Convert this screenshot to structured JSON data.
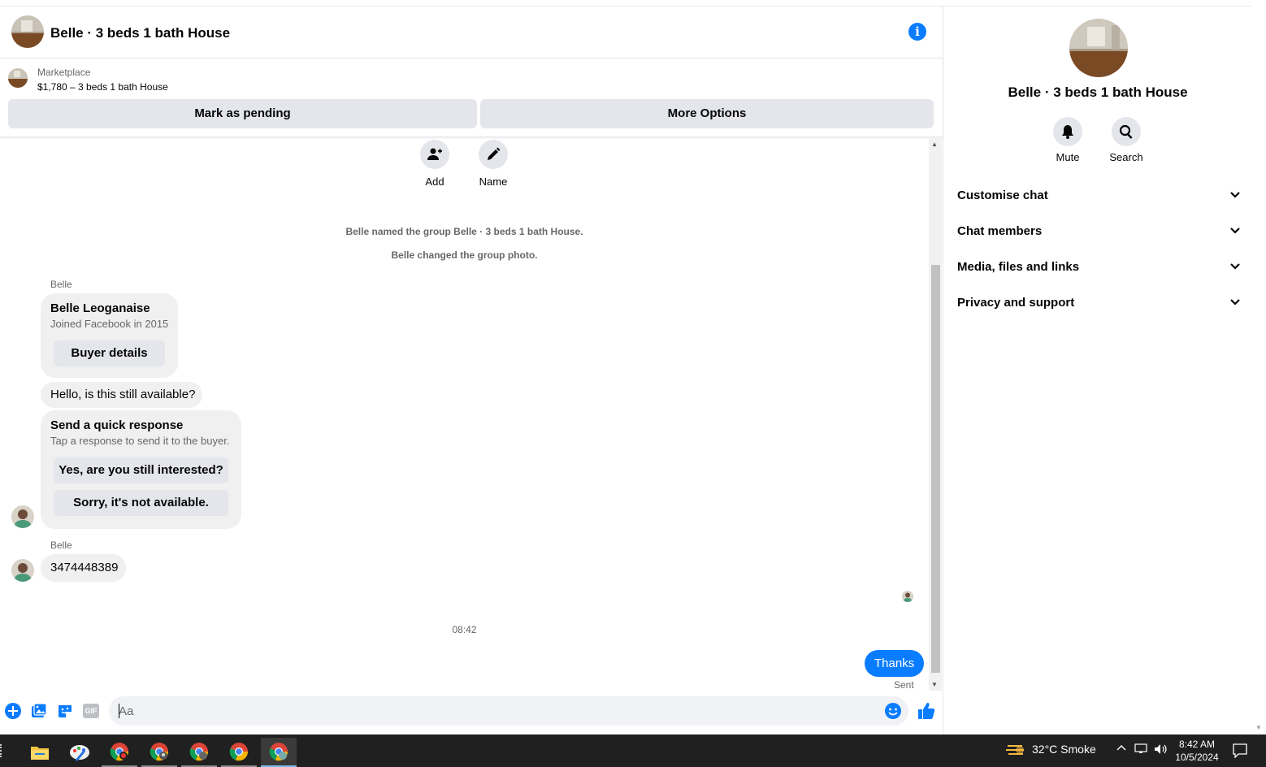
{
  "header": {
    "title": "Belle · 3 beds 1 bath House",
    "info_icon": "info-icon"
  },
  "marketplace": {
    "label": "Marketplace",
    "listing": "$1,780 – 3 beds 1 bath House",
    "mark_pending": "Mark as pending",
    "more_options": "More Options"
  },
  "actions": {
    "add": "Add",
    "name": "Name"
  },
  "system_messages": [
    "Belle named the group Belle · 3 beds 1 bath House.",
    "Belle changed the group photo."
  ],
  "messages": {
    "sender_1": "Belle",
    "profile_name": "Belle Leoganaise",
    "profile_joined": "Joined Facebook in 2015",
    "buyer_details": "Buyer details",
    "question": "Hello, is this still available?",
    "quick_title": "Send a quick response",
    "quick_sub": "Tap a response to send it to the buyer.",
    "quick_1": "Yes, are you still interested?",
    "quick_2": "Sorry, it's not available.",
    "sender_2": "Belle",
    "phone": "3474448389",
    "time": "08:42",
    "reply": "Thanks",
    "status": "Sent"
  },
  "composer": {
    "placeholder": "Aa",
    "gif_label": "GIF"
  },
  "side": {
    "title": "Belle · 3 beds 1 bath House",
    "mute": "Mute",
    "search": "Search",
    "sections": [
      "Customise chat",
      "Chat members",
      "Media, files and links",
      "Privacy and support"
    ]
  },
  "taskbar": {
    "weather": "32°C  Smoke",
    "time": "8:42 AM",
    "date": "10/5/2024"
  },
  "colors": {
    "accent": "#0a7cff",
    "bubble_gray": "#f0f0f0",
    "button_gray": "#e4e6eb"
  }
}
